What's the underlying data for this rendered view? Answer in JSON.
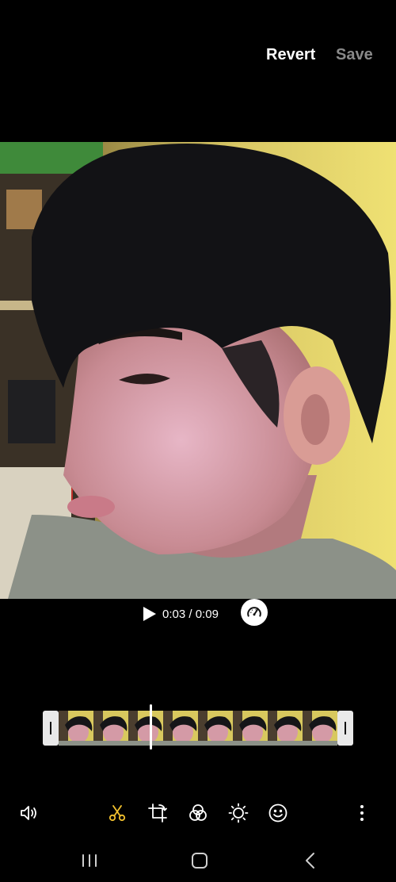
{
  "header": {
    "revert_label": "Revert",
    "save_label": "Save"
  },
  "playback": {
    "current_time": "0:03",
    "separator": " / ",
    "duration": "0:09",
    "progress": 0.33
  },
  "toolbar": {
    "items": [
      {
        "name": "volume",
        "icon": "speaker-icon"
      },
      {
        "name": "trim",
        "icon": "scissors-icon",
        "active": true
      },
      {
        "name": "crop-rotate",
        "icon": "crop-rotate-icon"
      },
      {
        "name": "filters",
        "icon": "filters-icon"
      },
      {
        "name": "adjust",
        "icon": "brightness-icon"
      },
      {
        "name": "stickers",
        "icon": "smiley-icon"
      },
      {
        "name": "more",
        "icon": "more-vertical-icon"
      }
    ]
  },
  "navbar": {
    "items": [
      "recent-apps-icon",
      "home-icon",
      "back-icon"
    ]
  },
  "colors": {
    "active_tool": "#f2c12e",
    "save_disabled": "#8a8a8a",
    "background": "#000000"
  }
}
